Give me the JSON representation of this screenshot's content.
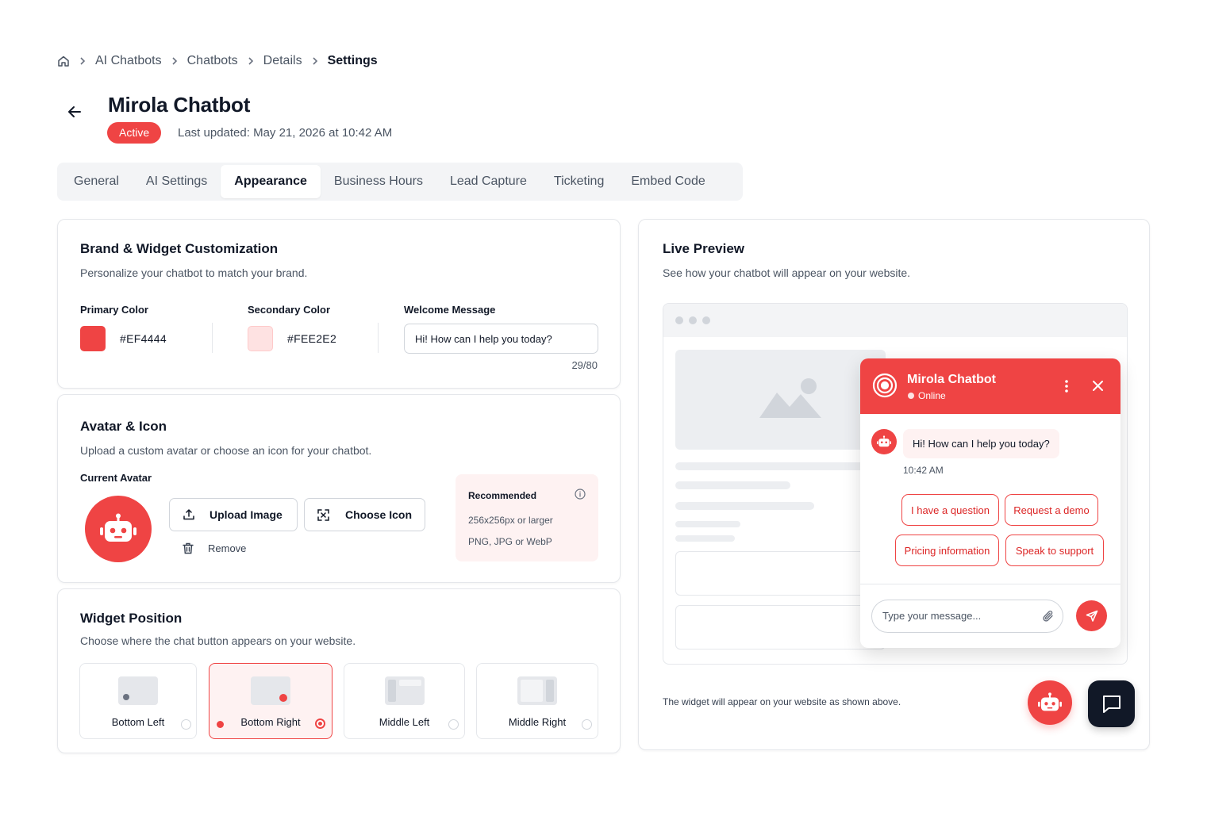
{
  "breadcrumb": {
    "items": [
      "AI Chatbots",
      "Chatbots",
      "Details"
    ],
    "current": "Settings"
  },
  "header": {
    "title": "Mirola Chatbot",
    "status": "Active",
    "last_updated": "Last updated: May 21, 2026 at 10:42 AM"
  },
  "tabs": [
    {
      "label": "General"
    },
    {
      "label": "AI Settings"
    },
    {
      "label": "Appearance",
      "active": true
    },
    {
      "label": "Business Hours"
    },
    {
      "label": "Lead Capture"
    },
    {
      "label": "Ticketing"
    },
    {
      "label": "Embed Code"
    }
  ],
  "brand": {
    "title": "Brand & Widget Customization",
    "subtitle": "Personalize your chatbot to match your brand.",
    "primary_label": "Primary Color",
    "primary_value": "#EF4444",
    "secondary_label": "Secondary Color",
    "secondary_value": "#FEE2E2",
    "welcome_label": "Welcome Message",
    "welcome_value": "Hi! How can I help you today?",
    "welcome_count": "29/80"
  },
  "avatar": {
    "title": "Avatar & Icon",
    "subtitle": "Upload a custom avatar or choose an icon for your chatbot.",
    "current_label": "Current Avatar",
    "upload_label": "Upload Image",
    "choose_label": "Choose Icon",
    "remove_label": "Remove",
    "rec_title": "Recommended",
    "rec_size": "256x256px or larger",
    "rec_formats": "PNG, JPG or WebP",
    "icon": "robot-icon"
  },
  "position": {
    "title": "Widget Position",
    "subtitle": "Choose where the chat button appears on your website.",
    "options": [
      {
        "label": "Bottom Left",
        "selected": false
      },
      {
        "label": "Bottom Right",
        "selected": true
      },
      {
        "label": "Middle Left",
        "selected": false
      },
      {
        "label": "Middle Right",
        "selected": false
      }
    ]
  },
  "preview": {
    "title": "Live Preview",
    "subtitle": "See how your chatbot will appear on your website.",
    "footer_note": "The widget will appear on your website as shown above.",
    "widget": {
      "name": "Mirola Chatbot",
      "status": "Online",
      "message": "Hi! How can I help you today?",
      "time": "10:42 AM",
      "quick_replies": [
        "I have a question",
        "Request a demo",
        "Pricing information",
        "Speak to support"
      ],
      "input_placeholder": "Type your message..."
    }
  },
  "colors": {
    "primary": "#EF4444",
    "secondary": "#FEE2E2",
    "dark_launcher": "#111827"
  }
}
